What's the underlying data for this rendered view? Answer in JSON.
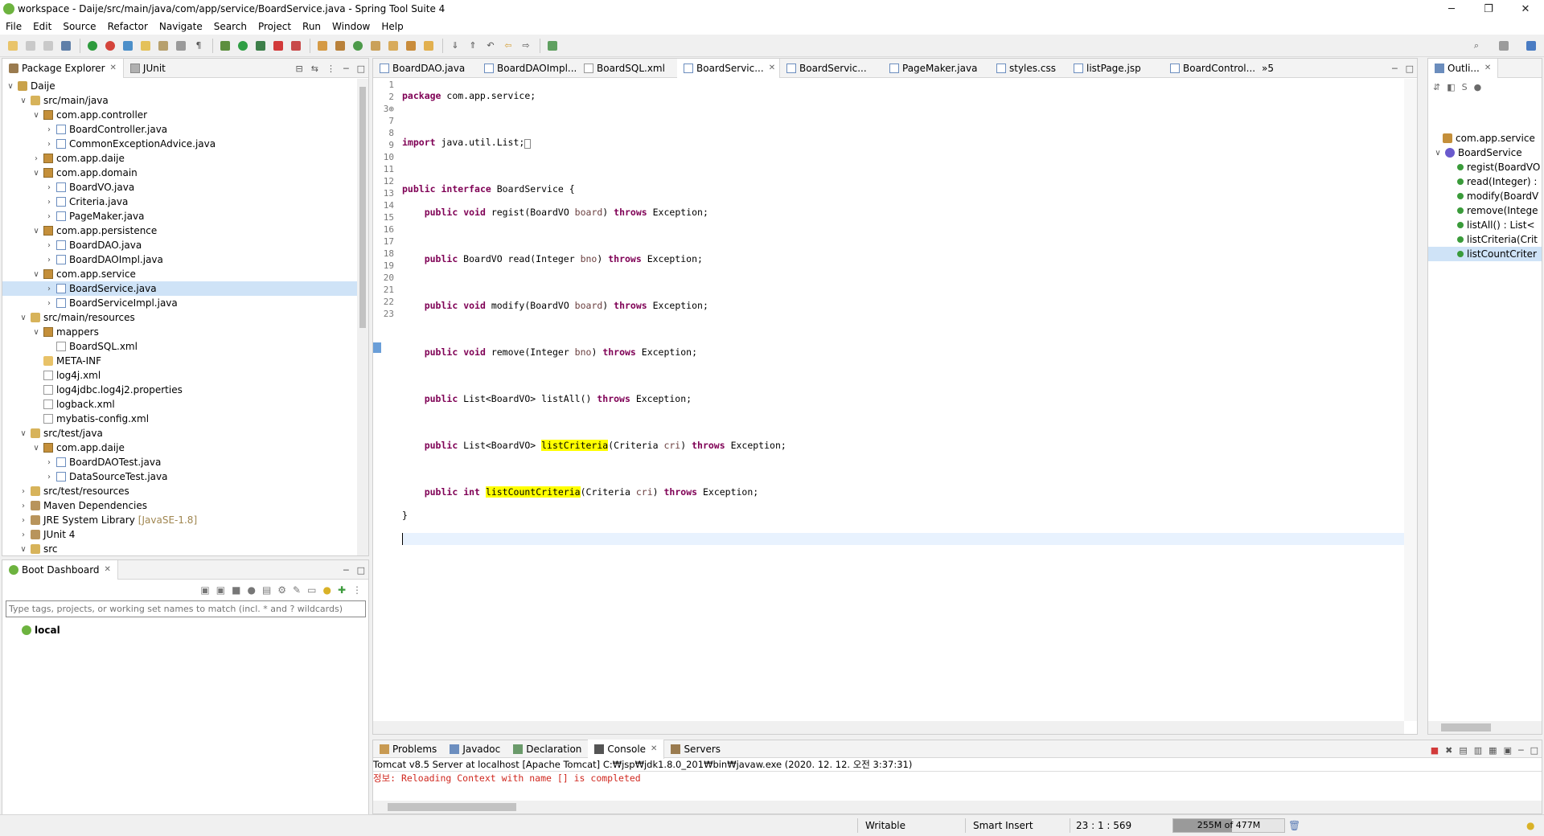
{
  "window": {
    "title": "workspace - Daije/src/main/java/com/app/service/BoardService.java - Spring Tool Suite 4",
    "minimize": "─",
    "maximize": "❐",
    "close": "✕"
  },
  "menu": [
    "File",
    "Edit",
    "Source",
    "Refactor",
    "Navigate",
    "Search",
    "Project",
    "Run",
    "Window",
    "Help"
  ],
  "package_explorer": {
    "tabs": [
      "Package Explorer",
      "JUnit"
    ],
    "tree": [
      {
        "label": "Daije",
        "indent": 0,
        "tw": "∨",
        "icon": "proj"
      },
      {
        "label": "src/main/java",
        "indent": 1,
        "tw": "∨",
        "icon": "src"
      },
      {
        "label": "com.app.controller",
        "indent": 2,
        "tw": "∨",
        "icon": "pkg"
      },
      {
        "label": "BoardController.java",
        "indent": 3,
        "tw": "›",
        "icon": "java"
      },
      {
        "label": "CommonExceptionAdvice.java",
        "indent": 3,
        "tw": "›",
        "icon": "java"
      },
      {
        "label": "com.app.daije",
        "indent": 2,
        "tw": "›",
        "icon": "pkg"
      },
      {
        "label": "com.app.domain",
        "indent": 2,
        "tw": "∨",
        "icon": "pkg"
      },
      {
        "label": "BoardVO.java",
        "indent": 3,
        "tw": "›",
        "icon": "java"
      },
      {
        "label": "Criteria.java",
        "indent": 3,
        "tw": "›",
        "icon": "java"
      },
      {
        "label": "PageMaker.java",
        "indent": 3,
        "tw": "›",
        "icon": "java"
      },
      {
        "label": "com.app.persistence",
        "indent": 2,
        "tw": "∨",
        "icon": "pkg"
      },
      {
        "label": "BoardDAO.java",
        "indent": 3,
        "tw": "›",
        "icon": "java"
      },
      {
        "label": "BoardDAOImpl.java",
        "indent": 3,
        "tw": "›",
        "icon": "java"
      },
      {
        "label": "com.app.service",
        "indent": 2,
        "tw": "∨",
        "icon": "pkg"
      },
      {
        "label": "BoardService.java",
        "indent": 3,
        "tw": "›",
        "icon": "java",
        "selected": true
      },
      {
        "label": "BoardServiceImpl.java",
        "indent": 3,
        "tw": "›",
        "icon": "java"
      },
      {
        "label": "src/main/resources",
        "indent": 1,
        "tw": "∨",
        "icon": "src"
      },
      {
        "label": "mappers",
        "indent": 2,
        "tw": "∨",
        "icon": "pkg"
      },
      {
        "label": "BoardSQL.xml",
        "indent": 3,
        "tw": "",
        "icon": "xml"
      },
      {
        "label": "META-INF",
        "indent": 2,
        "tw": "",
        "icon": "folder"
      },
      {
        "label": "log4j.xml",
        "indent": 2,
        "tw": "",
        "icon": "xml"
      },
      {
        "label": "log4jdbc.log4j2.properties",
        "indent": 2,
        "tw": "",
        "icon": "xml"
      },
      {
        "label": "logback.xml",
        "indent": 2,
        "tw": "",
        "icon": "xml"
      },
      {
        "label": "mybatis-config.xml",
        "indent": 2,
        "tw": "",
        "icon": "xml"
      },
      {
        "label": "src/test/java",
        "indent": 1,
        "tw": "∨",
        "icon": "src"
      },
      {
        "label": "com.app.daije",
        "indent": 2,
        "tw": "∨",
        "icon": "pkg"
      },
      {
        "label": "BoardDAOTest.java",
        "indent": 3,
        "tw": "›",
        "icon": "java"
      },
      {
        "label": "DataSourceTest.java",
        "indent": 3,
        "tw": "›",
        "icon": "java"
      },
      {
        "label": "src/test/resources",
        "indent": 1,
        "tw": "›",
        "icon": "src"
      },
      {
        "label": "Maven Dependencies",
        "indent": 1,
        "tw": "›",
        "icon": "jar"
      },
      {
        "label": "JRE System Library",
        "indent": 1,
        "tw": "›",
        "icon": "jar",
        "suffix": "[JavaSE-1.8]"
      },
      {
        "label": "JUnit 4",
        "indent": 1,
        "tw": "›",
        "icon": "jar"
      },
      {
        "label": "src",
        "indent": 1,
        "tw": "∨",
        "icon": "src"
      }
    ]
  },
  "boot_dashboard": {
    "tab": "Boot Dashboard",
    "filter_placeholder": "Type tags, projects, or working set names to match (incl. * and ? wildcards)",
    "items": [
      "local"
    ]
  },
  "editor": {
    "tabs": [
      "BoardDAO.java",
      "BoardDAOImpl...",
      "BoardSQL.xml",
      "BoardServic...",
      "BoardServic...",
      "PageMaker.java",
      "styles.css",
      "listPage.jsp",
      "BoardControl..."
    ],
    "overflow": "»5",
    "line_numbers": [
      "1",
      "2",
      "3⊕",
      "7",
      "8",
      "9",
      "10",
      "11",
      "12",
      "13",
      "14",
      "15",
      "16",
      "17",
      "18",
      "19",
      "20",
      "21",
      "22",
      "23"
    ]
  },
  "outline": {
    "tab": "Outli...",
    "items": [
      "com.app.service",
      "BoardService",
      "regist(BoardVO",
      "read(Integer) :",
      "modify(BoardV",
      "remove(Intege",
      "listAll() : List<",
      "listCriteria(Crit",
      "listCountCriter"
    ]
  },
  "bottom": {
    "tabs": [
      "Problems",
      "Javadoc",
      "Declaration",
      "Console",
      "Servers"
    ],
    "console_header": "Tomcat v8.5 Server at localhost [Apache Tomcat] C:₩jsp₩jdk1.8.0_201₩bin₩javaw.exe  (2020. 12. 12. 오전 3:37:31)",
    "console_line": "정보: Reloading Context with name [] is completed"
  },
  "status": {
    "writable": "Writable",
    "insert": "Smart Insert",
    "position": "23 : 1 : 569",
    "heap": "255M of 477M",
    "heap_fraction": 0.53
  }
}
